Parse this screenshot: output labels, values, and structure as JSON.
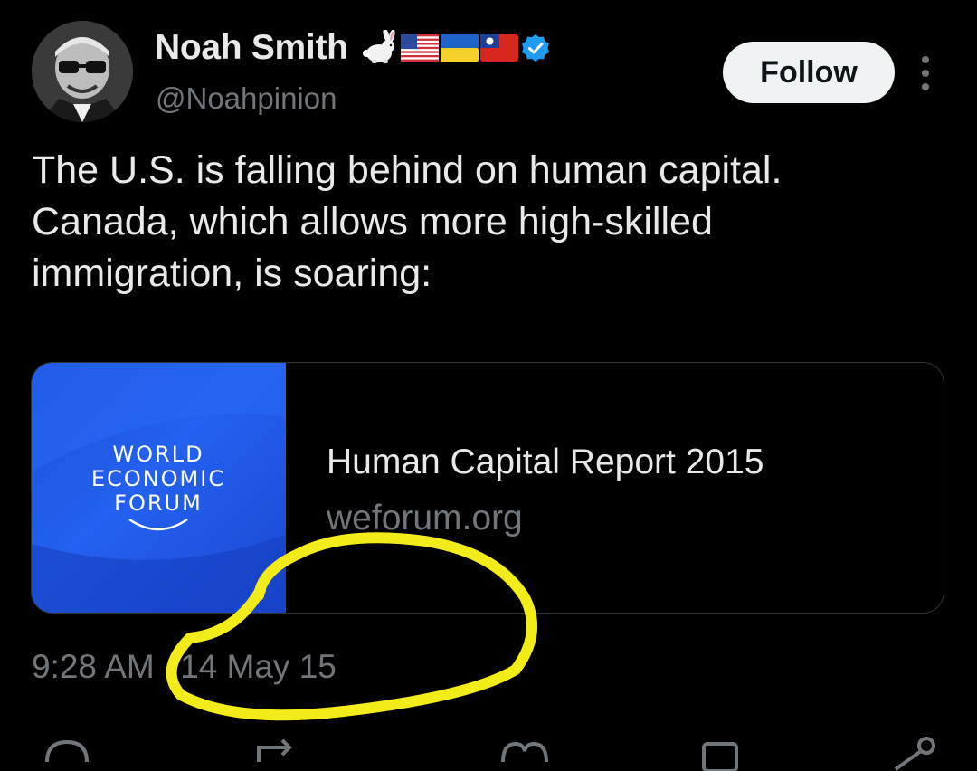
{
  "author": {
    "display_name": "Noah Smith",
    "handle": "@Noahpinion",
    "emoji_icons": [
      "rabbit-icon",
      "us-flag-icon",
      "ukraine-flag-icon",
      "taiwan-flag-icon"
    ],
    "verified": true
  },
  "follow_button": {
    "label": "Follow"
  },
  "tweet": {
    "lines": [
      "The U.S. is falling behind on human capital.",
      "Canada, which allows more high-skilled",
      "immigration, is soaring:"
    ]
  },
  "link_card": {
    "logo_lines": [
      "WORLD",
      "ECONOMIC",
      "FORUM"
    ],
    "title": "Human Capital Report 2015",
    "domain": "weforum.org"
  },
  "timestamp": {
    "time": "9:28 AM",
    "separator": "·",
    "date": "14 May 15"
  },
  "colors": {
    "background": "#000000",
    "primary_text": "#e7e9ea",
    "secondary_text": "#71767b",
    "verified_blue": "#1d9bf0",
    "highlight_yellow": "#f2ec1a",
    "wef_blue": "#2461f0"
  }
}
